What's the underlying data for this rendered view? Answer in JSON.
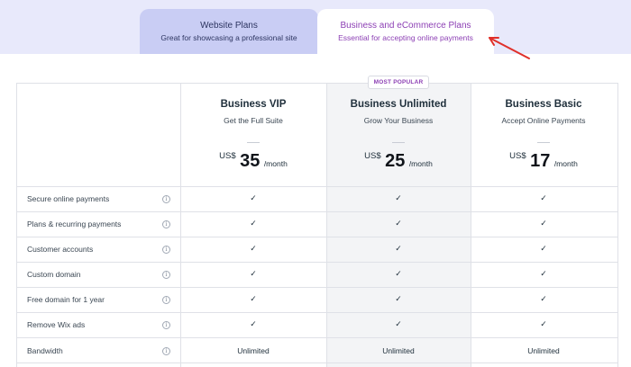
{
  "tabs": {
    "website": {
      "title": "Website Plans",
      "subtitle": "Great for showcasing a professional site"
    },
    "ecommerce": {
      "title": "Business and eCommerce Plans",
      "subtitle": "Essential for accepting online payments"
    }
  },
  "badge": "MOST POPULAR",
  "plans": [
    {
      "name": "Business VIP",
      "tagline": "Get the Full Suite",
      "currency": "US$",
      "price": "35",
      "period": "/month"
    },
    {
      "name": "Business Unlimited",
      "tagline": "Grow Your Business",
      "currency": "US$",
      "price": "25",
      "period": "/month"
    },
    {
      "name": "Business Basic",
      "tagline": "Accept Online Payments",
      "currency": "US$",
      "price": "17",
      "period": "/month"
    }
  ],
  "features": [
    {
      "label": "Secure online payments",
      "values": [
        "✓",
        "✓",
        "✓"
      ]
    },
    {
      "label": "Plans & recurring payments",
      "values": [
        "✓",
        "✓",
        "✓"
      ]
    },
    {
      "label": "Customer accounts",
      "values": [
        "✓",
        "✓",
        "✓"
      ]
    },
    {
      "label": "Custom domain",
      "values": [
        "✓",
        "✓",
        "✓"
      ]
    },
    {
      "label": "Free domain for 1 year",
      "values": [
        "✓",
        "✓",
        "✓"
      ]
    },
    {
      "label": "Remove Wix ads",
      "values": [
        "✓",
        "✓",
        "✓"
      ]
    },
    {
      "label": "Bandwidth",
      "values": [
        "Unlimited",
        "Unlimited",
        "Unlimited"
      ]
    }
  ],
  "info_glyph": "i",
  "colors": {
    "accent": "#8c3fb4",
    "tab_band": "#e8e9fb",
    "tab_inactive": "#c9cdf4",
    "highlight_column": "#f3f4f6",
    "annotation": "#e0302a"
  }
}
